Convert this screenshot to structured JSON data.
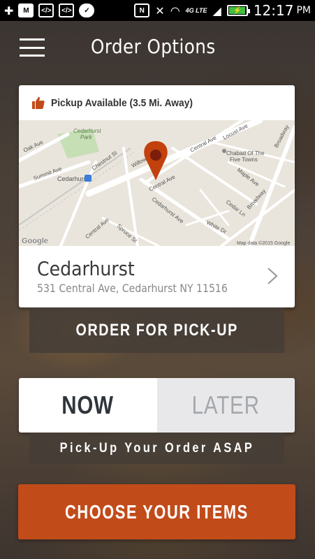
{
  "status_bar": {
    "time": "12:17",
    "ampm": "PM",
    "network": "4G LTE",
    "battery_level": 0.9,
    "icons": [
      "add-icon",
      "gmail-icon",
      "code-icon",
      "code-icon",
      "check-icon",
      "nfc-icon",
      "mute-icon",
      "wifi-icon",
      "signal-icon",
      "battery-icon"
    ]
  },
  "header": {
    "title": "Order Options",
    "menu_icon": "hamburger-menu-icon"
  },
  "location": {
    "pickup_label": "Pickup Available (3.5 Mi. Away)",
    "pickup_icon": "thumbs-up-icon",
    "map": {
      "streets": [
        "Oak Ave",
        "Summit Ave",
        "Chestnut St",
        "Willow Ave",
        "Central Ave",
        "Locust Ave",
        "Broadway",
        "Maple Ave",
        "Cedarhurst Ave",
        "Cedar Ln",
        "Central Ave",
        "Spruce St",
        "White Dr",
        "Broadway"
      ],
      "places": [
        "Cedarhurst Park",
        "Cedarhurst",
        "Chabad Of The Five Towns"
      ],
      "attribution": "Map data ©2015 Google",
      "logo": "Google"
    },
    "store_name": "Cedarhurst",
    "store_address": "531 Central Ave, Cedarhurst NY 11516"
  },
  "actions": {
    "order_for_pickup": "ORDER FOR PICK-UP",
    "now": "NOW",
    "later": "LATER",
    "asap_note": "Pick-Up Your Order ASAP",
    "choose_items": "CHOOSE YOUR ITEMS"
  },
  "colors": {
    "accent": "#c24b1a",
    "pin": "#c2410c",
    "active_toggle_text": "#2f353b",
    "inactive_toggle_text": "#a4a7ab"
  }
}
